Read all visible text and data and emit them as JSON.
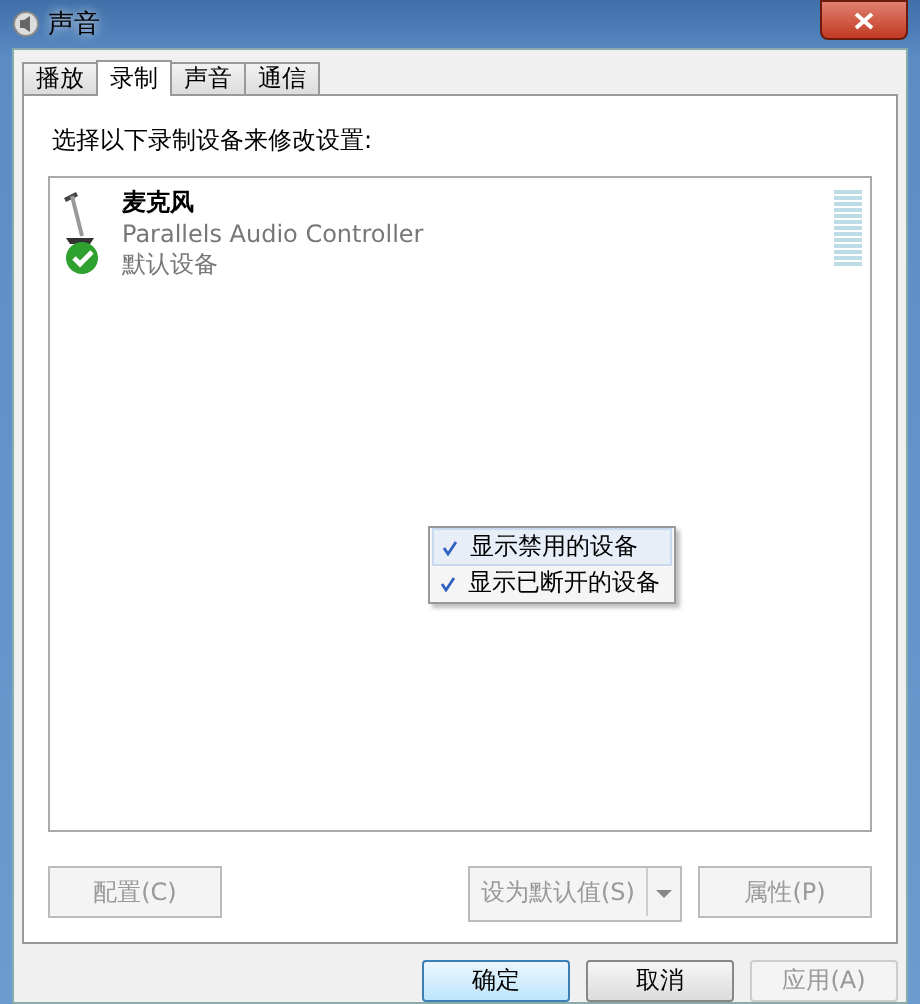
{
  "window": {
    "title": "声音"
  },
  "tabs": [
    {
      "label": "播放",
      "selected": false
    },
    {
      "label": "录制",
      "selected": true
    },
    {
      "label": "声音",
      "selected": false
    },
    {
      "label": "通信",
      "selected": false
    }
  ],
  "instruction": "选择以下录制设备来修改设置:",
  "devices": [
    {
      "name": "麦克风",
      "driver": "Parallels Audio Controller",
      "status": "默认设备",
      "default": true
    }
  ],
  "context_menu": [
    {
      "label": "显示禁用的设备",
      "checked": true
    },
    {
      "label": "显示已断开的设备",
      "checked": true
    }
  ],
  "panel_buttons": [
    {
      "label": "配置(C)",
      "disabled": true,
      "kind": "plain"
    },
    {
      "label": "设为默认值(S)",
      "disabled": true,
      "kind": "split"
    },
    {
      "label": "属性(P)",
      "disabled": true,
      "kind": "plain"
    }
  ],
  "dialog_buttons": [
    {
      "label": "确定",
      "disabled": false,
      "default": true
    },
    {
      "label": "取消",
      "disabled": false,
      "default": false
    },
    {
      "label": "应用(A)",
      "disabled": true,
      "default": false
    }
  ]
}
